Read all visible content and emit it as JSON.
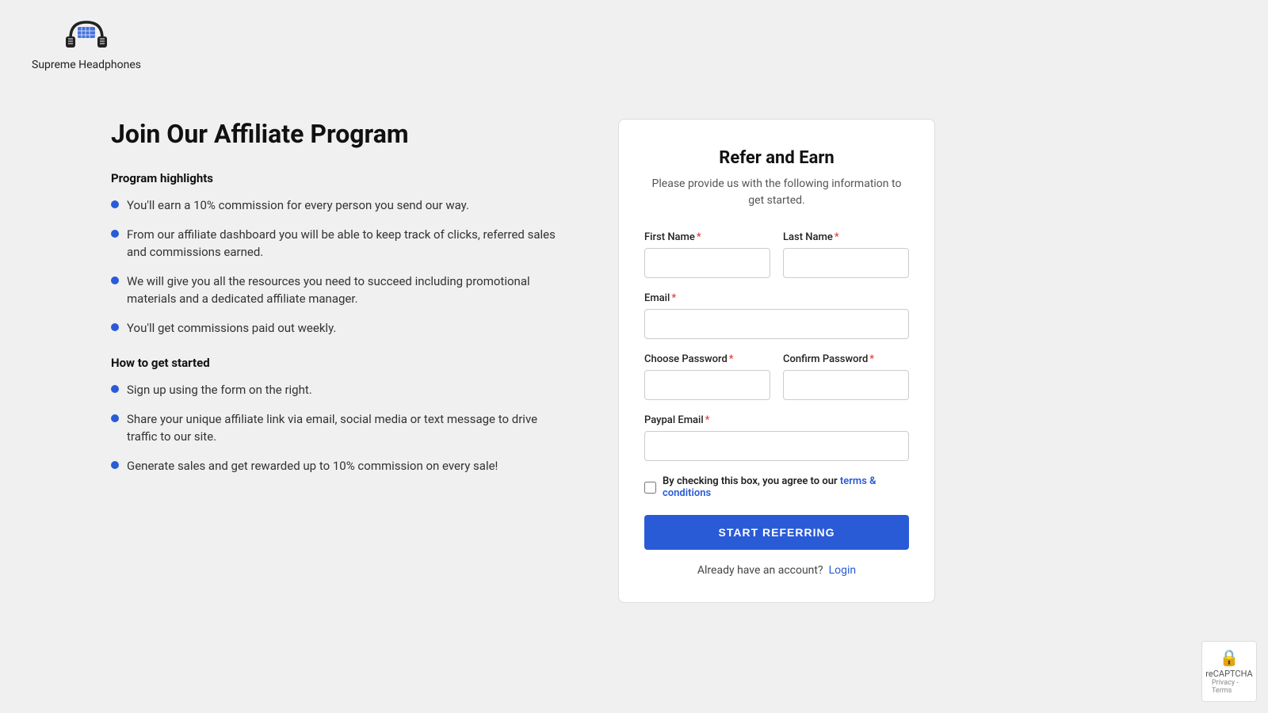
{
  "header": {
    "brand_name": "Supreme Headphones"
  },
  "left": {
    "page_title": "Join Our Affiliate Program",
    "highlights_heading": "Program highlights",
    "highlights": [
      "You'll earn a 10% commission for every person you send our way.",
      "From our affiliate dashboard you will be able to keep track of clicks, referred sales and commissions earned.",
      "We will give you all the resources you need to succeed including promotional materials and a dedicated affiliate manager.",
      "You'll get commissions paid out weekly."
    ],
    "how_to_heading": "How to get started",
    "how_to": [
      "Sign up using the form on the right.",
      "Share your unique affiliate link via email, social media or text message to drive traffic to our site.",
      "Generate sales and get rewarded up to 10% commission on every sale!"
    ]
  },
  "form": {
    "title": "Refer and Earn",
    "subtitle": "Please provide us with the following information to get started.",
    "first_name_label": "First Name",
    "last_name_label": "Last Name",
    "email_label": "Email",
    "choose_password_label": "Choose Password",
    "confirm_password_label": "Confirm Password",
    "paypal_email_label": "Paypal Email",
    "checkbox_text": "By checking this box, you agree to our",
    "terms_link": "terms & conditions",
    "submit_label": "START REFERRING",
    "already_account_text": "Already have an account?",
    "login_link": "Login"
  },
  "recaptcha": {
    "label": "reCAPTCHA",
    "sublabel": "Privacy - Terms"
  }
}
